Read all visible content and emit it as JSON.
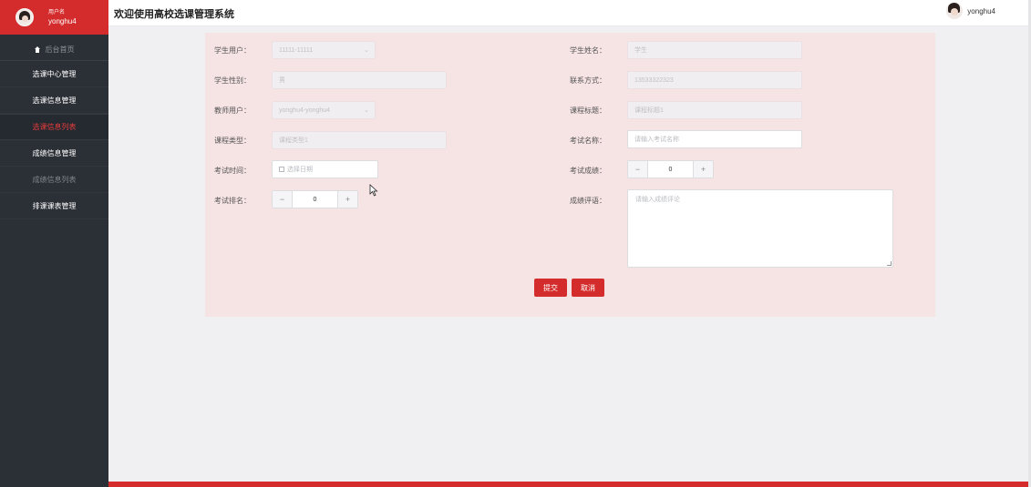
{
  "sidebar": {
    "user": {
      "role": "用户名",
      "name": "yonghu4"
    },
    "items": [
      {
        "label": "后台首页"
      },
      {
        "label": "选课中心管理"
      },
      {
        "label": "选课信息管理"
      },
      {
        "label": "选课信息列表"
      },
      {
        "label": "成绩信息管理"
      },
      {
        "label": "成绩信息列表"
      },
      {
        "label": "排课课表管理"
      }
    ]
  },
  "header": {
    "title": "欢迎使用高校选课管理系统",
    "username": "yonghu4"
  },
  "form": {
    "student_user": {
      "label": "学生用户：",
      "value": "11111-11111"
    },
    "student_name": {
      "label": "学生姓名：",
      "value": "学生"
    },
    "student_gender": {
      "label": "学生性别：",
      "value": "男"
    },
    "contact": {
      "label": "联系方式：",
      "value": "13533322323"
    },
    "teacher_user": {
      "label": "教师用户：",
      "value": "yonghu4-yonghu4"
    },
    "course_title": {
      "label": "课程标题：",
      "value": "课程标题1"
    },
    "course_type": {
      "label": "课程类型：",
      "value": "课程类型1"
    },
    "exam_name": {
      "label": "考试名称：",
      "placeholder": "请输入考试名称"
    },
    "exam_time": {
      "label": "考试时间：",
      "placeholder": "选择日期"
    },
    "exam_score": {
      "label": "考试成绩：",
      "value": "0"
    },
    "exam_rank": {
      "label": "考试排名：",
      "value": "0"
    },
    "score_comment": {
      "label": "成绩评语：",
      "placeholder": "请输入成绩评论"
    },
    "submit_label": "提交",
    "cancel_label": "取消"
  },
  "colors": {
    "accent": "#d42c2c",
    "sidebar_bg": "#2b2f36",
    "panel_bg": "#f6e3e4"
  }
}
